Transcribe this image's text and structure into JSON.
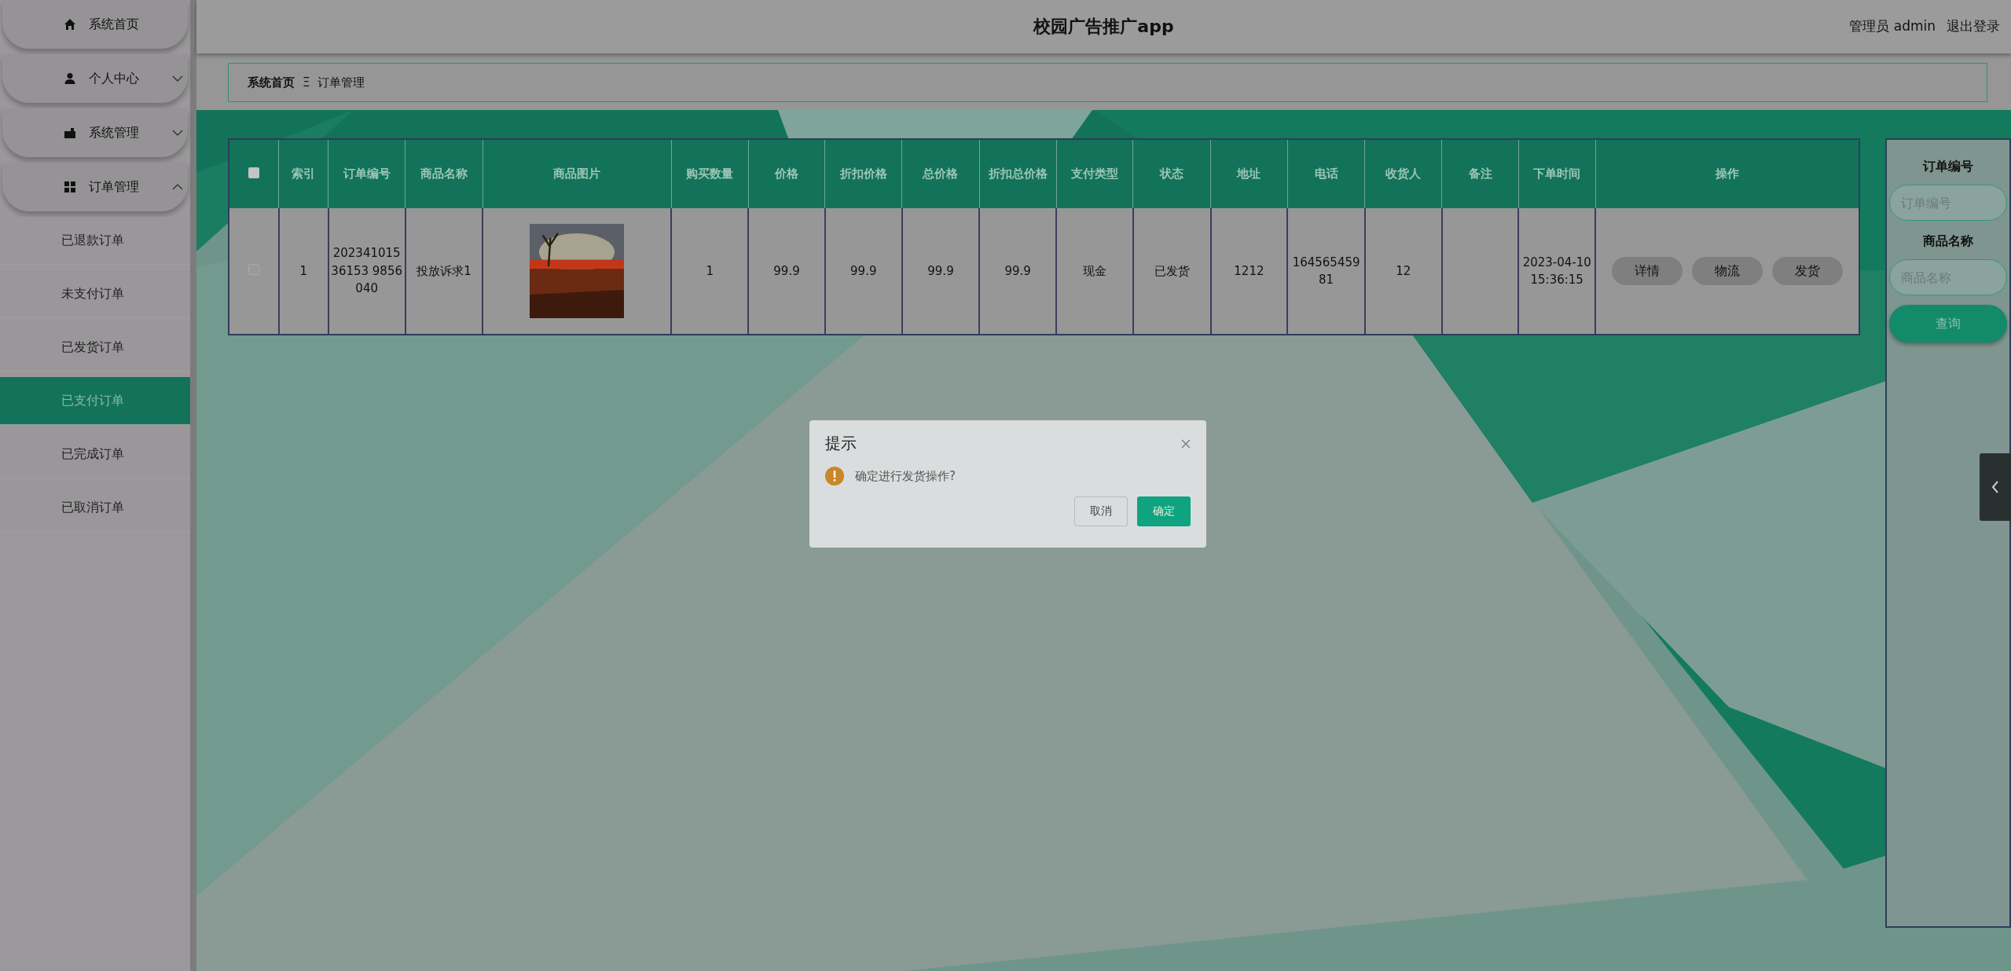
{
  "header": {
    "title": "校园广告推广app",
    "user": "管理员 admin",
    "logout": "退出登录"
  },
  "sidebar": {
    "items": [
      {
        "label": "系统首页"
      },
      {
        "label": "个人中心",
        "expanded": false
      },
      {
        "label": "系统管理",
        "expanded": false
      },
      {
        "label": "订单管理",
        "expanded": true,
        "children": [
          {
            "label": "已退款订单",
            "selected": false
          },
          {
            "label": "未支付订单",
            "selected": false
          },
          {
            "label": "已发货订单",
            "selected": false
          },
          {
            "label": "已支付订单",
            "selected": true
          },
          {
            "label": "已完成订单",
            "selected": false
          },
          {
            "label": "已取消订单",
            "selected": false
          }
        ]
      }
    ]
  },
  "breadcrumb": {
    "items": [
      "系统首页",
      "订单管理"
    ],
    "separator": "Ξ"
  },
  "table": {
    "select_all": {
      "checked": false
    },
    "columns": [
      "索引",
      "订单编号",
      "商品名称",
      "商品图片",
      "购买数量",
      "价格",
      "折扣价格",
      "总价格",
      "折扣总价格",
      "支付类型",
      "状态",
      "地址",
      "电话",
      "收货人",
      "备注",
      "下单时间",
      "操作"
    ],
    "rows": [
      {
        "checked": false,
        "cells": [
          "1",
          "20234101536153 9856040",
          "投放诉求1",
          {
            "kind": "picture"
          },
          "1",
          "99.9",
          "99.9",
          "99.9",
          "99.9",
          "现金",
          "已发货",
          "1212",
          "16456545981",
          "12",
          "",
          "2023-04-10 15:36:15"
        ],
        "actions": [
          "详情",
          "物流",
          "发货"
        ]
      }
    ]
  },
  "search": {
    "fields": [
      {
        "label": "订单编号",
        "placeholder": "订单编号"
      },
      {
        "label": "商品名称",
        "placeholder": "商品名称"
      }
    ],
    "button": "查询"
  },
  "dialog": {
    "title": "提示",
    "message": "确定进行发货操作?",
    "buttons": [
      {
        "label": "取消",
        "kind": "cancel"
      },
      {
        "label": "确定",
        "kind": "confirm"
      }
    ]
  }
}
